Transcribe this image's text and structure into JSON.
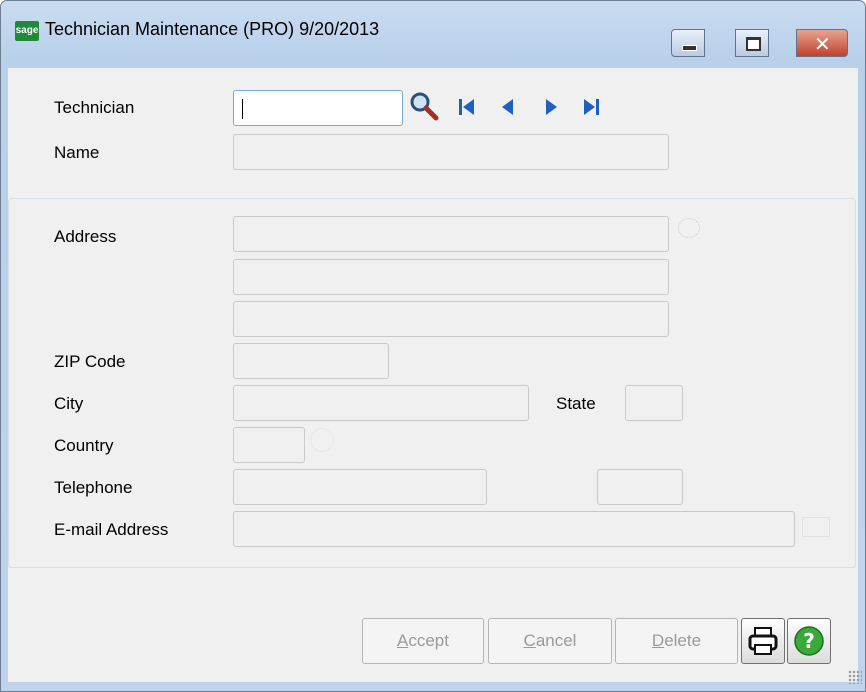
{
  "window": {
    "app_icon_text": "sage",
    "title": "Technician Maintenance (PRO) 9/20/2013",
    "close_glyph": "✕"
  },
  "form": {
    "technician_label": "Technician",
    "technician_value": "",
    "name_label": "Name",
    "address_label": "Address",
    "zip_label": "ZIP Code",
    "city_label": "City",
    "state_label": "State",
    "country_label": "Country",
    "telephone_label": "Telephone",
    "email_label": "E-mail Address"
  },
  "buttons": {
    "accept": {
      "prefix": "",
      "key": "A",
      "rest": "ccept"
    },
    "cancel": {
      "prefix": "",
      "key": "C",
      "rest": "ancel"
    },
    "delete": {
      "prefix": "",
      "key": "D",
      "rest": "elete"
    }
  },
  "icons": [
    "search-icon",
    "first-record-icon",
    "previous-record-icon",
    "next-record-icon",
    "last-record-icon",
    "printer-icon",
    "help-icon"
  ],
  "colors": {
    "accent": "#1f8a3c",
    "nav_blue": "#1f5fbf",
    "help_green": "#3aa83a"
  }
}
